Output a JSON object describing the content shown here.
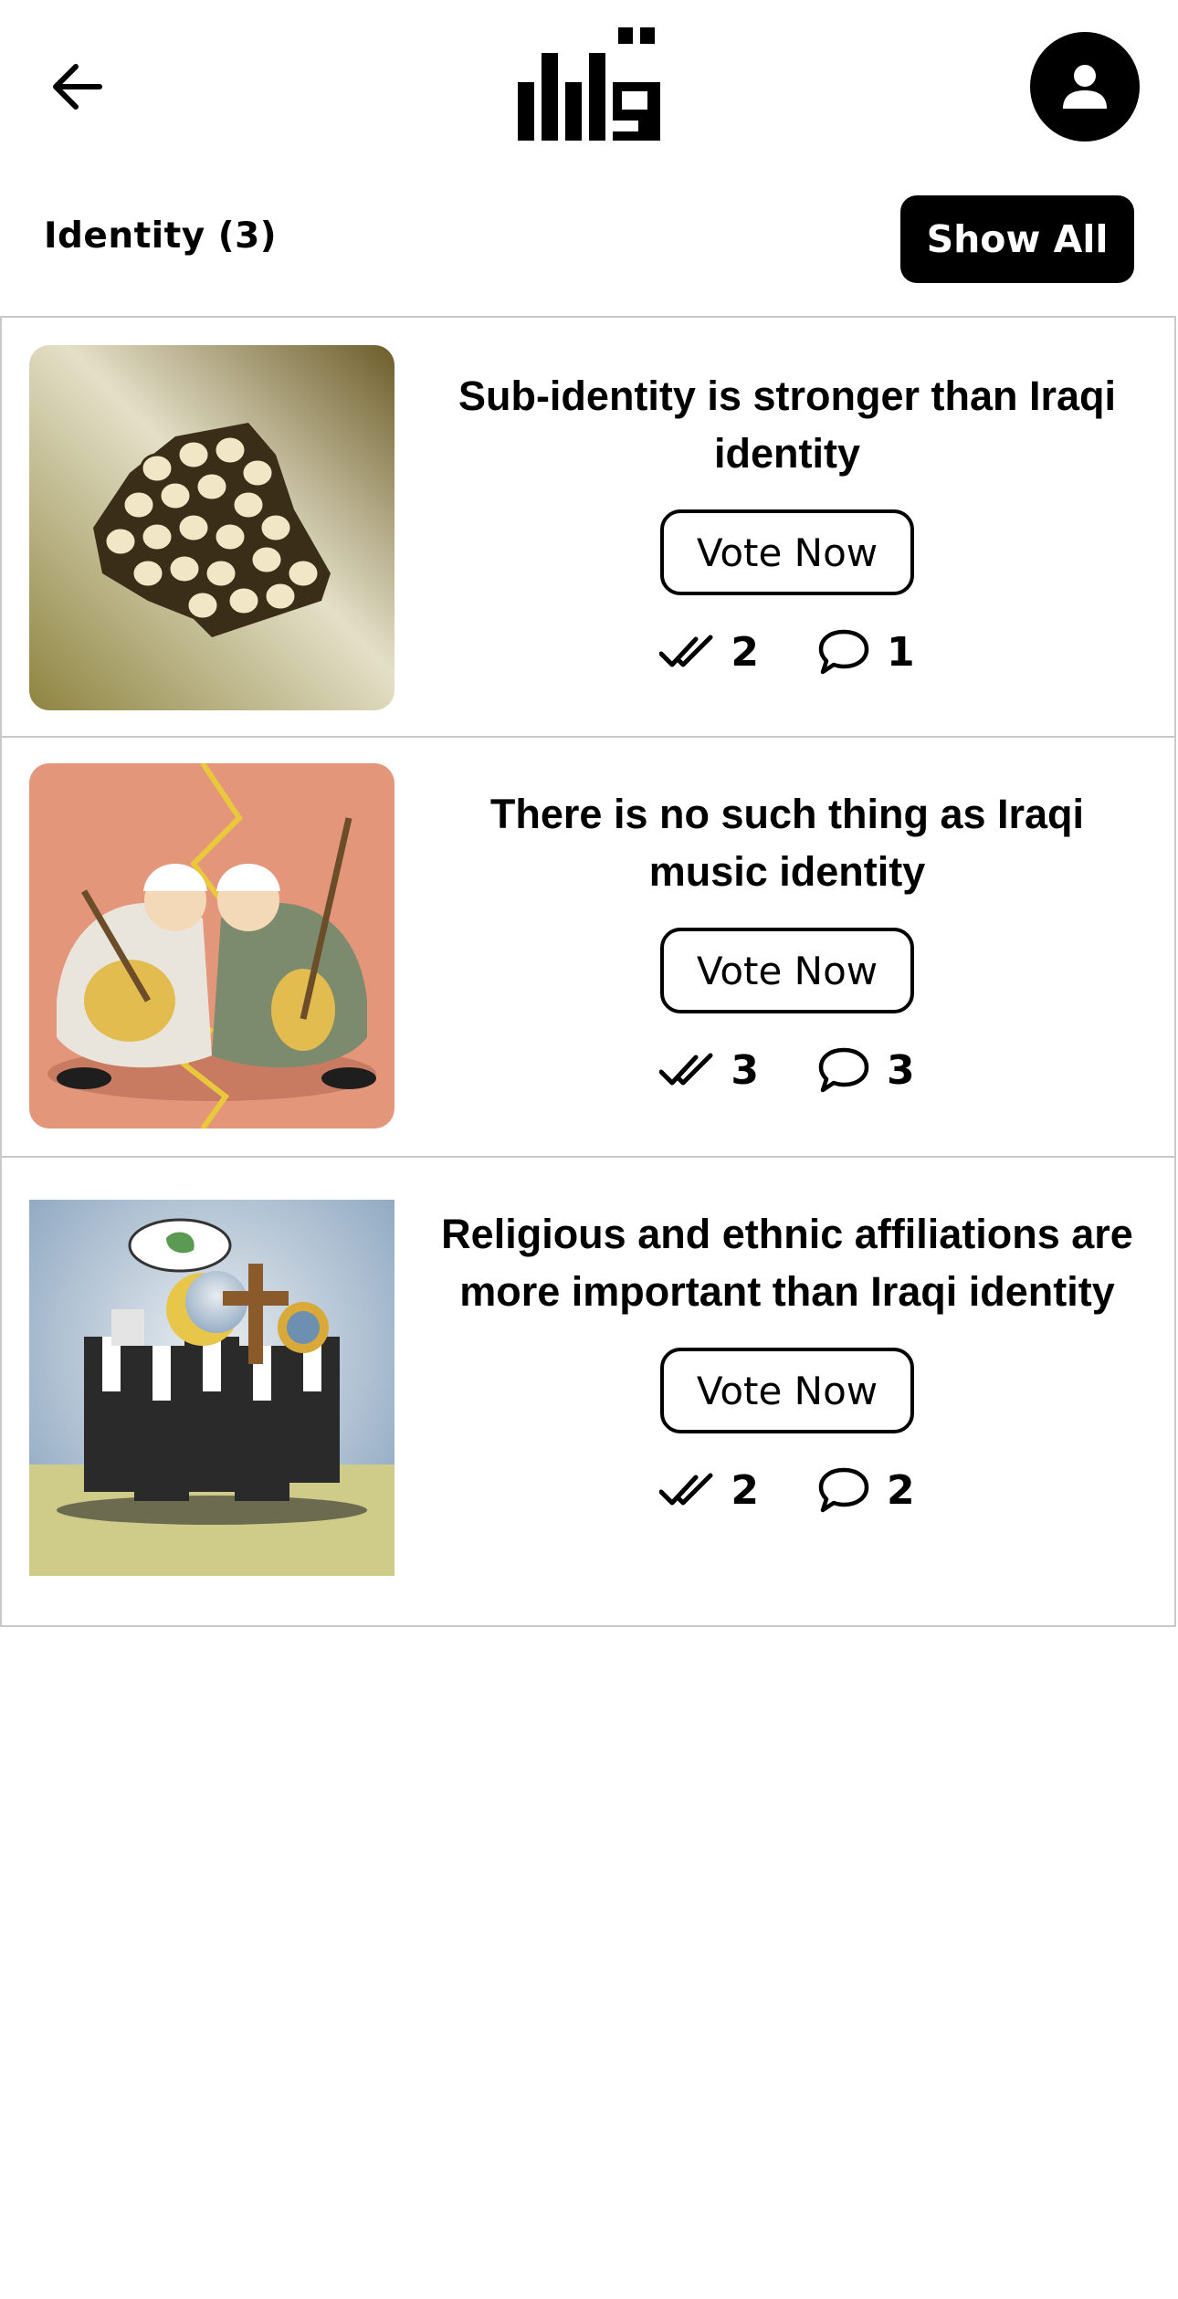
{
  "header": {
    "back_icon": "arrow-left-icon",
    "logo_text": "قرار",
    "profile_icon": "person-icon"
  },
  "section": {
    "title": "Identity (3)",
    "show_all_label": "Show All"
  },
  "topics": [
    {
      "title": "Sub-identity is stronger than Iraqi identity",
      "vote_label": "Vote Now",
      "votes": "2",
      "comments": "1",
      "image": "cartoon-map-of-iraq-filled-with-eggs"
    },
    {
      "title": "There is no such thing as Iraqi music identity",
      "vote_label": "Vote Now",
      "votes": "3",
      "comments": "3",
      "image": "cartoon-two-oud-players-split-by-lightning"
    },
    {
      "title": "Religious and ethnic affiliations are more important than Iraqi identity",
      "vote_label": "Vote Now",
      "votes": "2",
      "comments": "2",
      "image": "cartoon-men-with-religious-symbol-heads"
    }
  ],
  "colors": {
    "primary": "#000000",
    "background": "#ffffff",
    "divider": "#c8c8c8"
  }
}
